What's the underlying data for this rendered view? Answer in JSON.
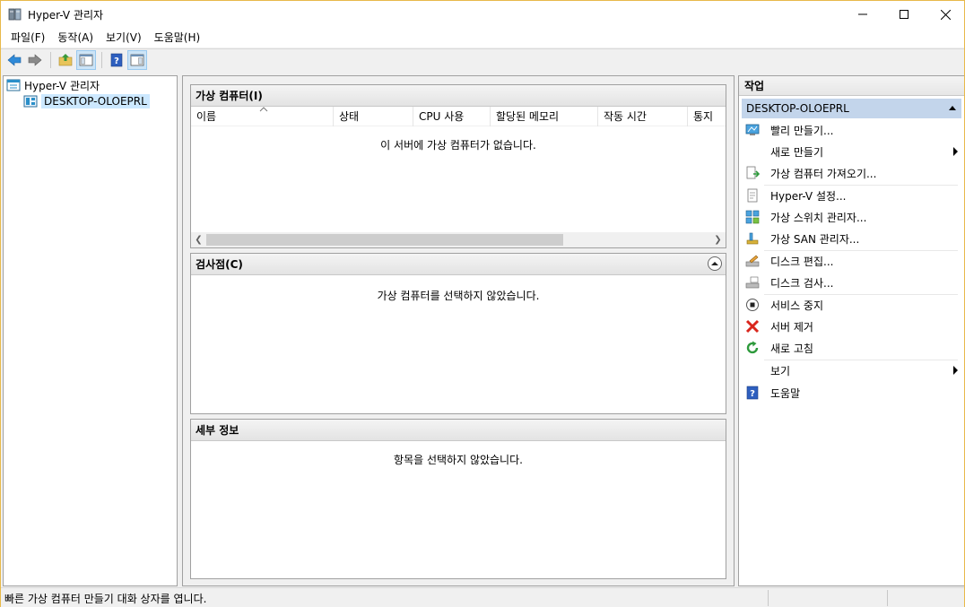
{
  "window": {
    "title": "Hyper-V 관리자"
  },
  "menu": [
    "파일(F)",
    "동작(A)",
    "보기(V)",
    "도움말(H)"
  ],
  "tree": {
    "root": "Hyper-V 관리자",
    "server": "DESKTOP-OLOEPRL"
  },
  "vm_panel": {
    "title": "가상 컴퓨터(I)",
    "columns": [
      "이름",
      "상태",
      "CPU 사용",
      "할당된 메모리",
      "작동 시간",
      "통지"
    ],
    "empty_message": "이 서버에 가상 컴퓨터가 없습니다."
  },
  "checkpoint_panel": {
    "title": "검사점(C)",
    "empty_message": "가상 컴퓨터를 선택하지 않았습니다."
  },
  "details_panel": {
    "title": "세부 정보",
    "empty_message": "항목을 선택하지 않았습니다."
  },
  "actions": {
    "header": "작업",
    "section": "DESKTOP-OLOEPRL",
    "items": [
      {
        "label": "빨리 만들기...",
        "icon": "quick-create-icon",
        "submenu": false
      },
      {
        "label": "새로 만들기",
        "icon": "",
        "submenu": true
      },
      {
        "label": "가상 컴퓨터 가져오기...",
        "icon": "import-vm-icon",
        "submenu": false
      },
      {
        "label": "Hyper-V 설정...",
        "icon": "settings-doc-icon",
        "submenu": false
      },
      {
        "label": "가상 스위치 관리자...",
        "icon": "virtual-switch-icon",
        "submenu": false
      },
      {
        "label": "가상 SAN 관리자...",
        "icon": "virtual-san-icon",
        "submenu": false
      },
      {
        "label": "디스크 편집...",
        "icon": "edit-disk-icon",
        "submenu": false
      },
      {
        "label": "디스크 검사...",
        "icon": "inspect-disk-icon",
        "submenu": false
      },
      {
        "label": "서비스 중지",
        "icon": "stop-service-icon",
        "submenu": false
      },
      {
        "label": "서버 제거",
        "icon": "remove-server-icon",
        "submenu": false
      },
      {
        "label": "새로 고침",
        "icon": "refresh-icon",
        "submenu": false
      },
      {
        "label": "보기",
        "icon": "",
        "submenu": true
      },
      {
        "label": "도움말",
        "icon": "help-icon",
        "submenu": false
      }
    ]
  },
  "status": {
    "text": "빠른 가상 컴퓨터 만들기 대화 상자를 엽니다."
  },
  "colors": {
    "selection_blue": "#cce8ff",
    "section_blue": "#c3d5eb",
    "window_border": "#e8b94a"
  }
}
